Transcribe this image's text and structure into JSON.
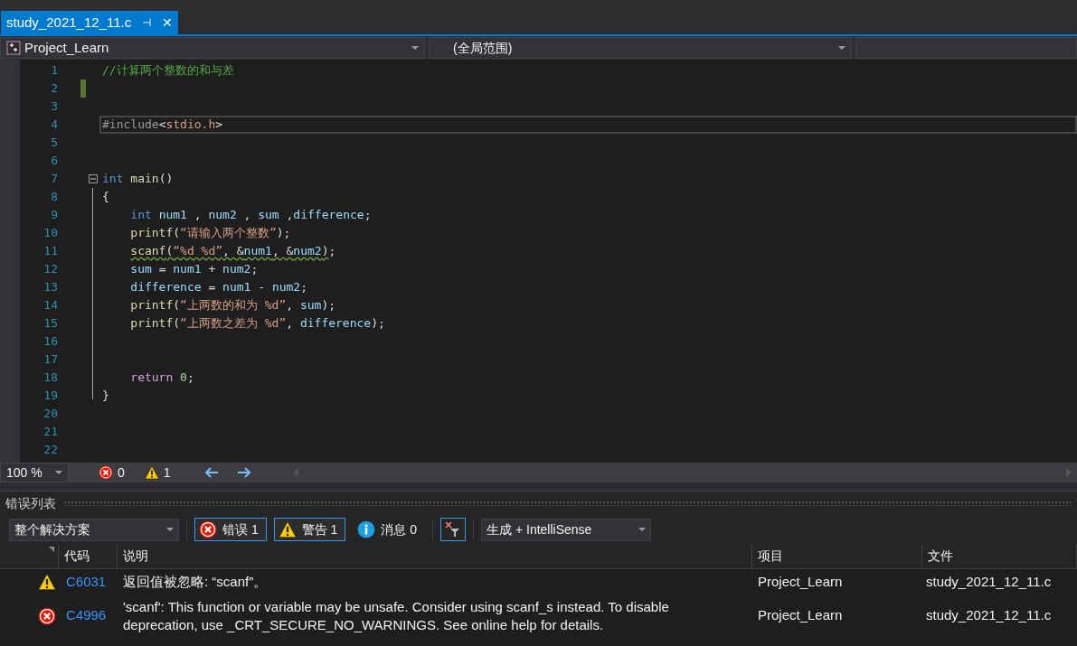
{
  "tab": {
    "title": "study_2021_12_11.c",
    "pin": "⊣",
    "close": "✕",
    "selected": true
  },
  "nav": {
    "project": "Project_Learn",
    "scope": "(全局范围)"
  },
  "editor": {
    "lines": [
      {
        "n": "1",
        "tokens": [
          {
            "kind": "comment",
            "text": "//计算两个整数的和与差"
          }
        ]
      },
      {
        "n": "2",
        "modified": true
      },
      {
        "n": "3"
      },
      {
        "n": "4",
        "current": true,
        "tokens": [
          {
            "kind": "preproc",
            "text": "#include"
          },
          {
            "kind": "plain",
            "text": "<"
          },
          {
            "kind": "string",
            "text": "stdio.h"
          },
          {
            "kind": "plain",
            "text": ">"
          }
        ]
      },
      {
        "n": "5"
      },
      {
        "n": "6"
      },
      {
        "n": "7",
        "expanded": true,
        "tokens": [
          {
            "kind": "keyword",
            "text": "int"
          },
          {
            "kind": "func",
            "text": " main"
          },
          {
            "kind": "plain",
            "text": "()"
          }
        ],
        "children": [
          {
            "n": "8",
            "tokens": [
              {
                "kind": "plain",
                "text": "{"
              }
            ]
          },
          {
            "n": "9",
            "tokens": [
              {
                "kind": "keyword",
                "text": "    int"
              },
              {
                "kind": "ident",
                "text": " num1"
              },
              {
                "kind": "plain",
                "text": " , "
              },
              {
                "kind": "ident",
                "text": "num2"
              },
              {
                "kind": "plain",
                "text": " , "
              },
              {
                "kind": "ident",
                "text": "sum"
              },
              {
                "kind": "plain",
                "text": " ,"
              },
              {
                "kind": "ident",
                "text": "difference"
              },
              {
                "kind": "plain",
                "text": ";"
              }
            ]
          },
          {
            "n": "10",
            "tokens": [
              {
                "kind": "func",
                "text": "    printf"
              },
              {
                "kind": "plain",
                "text": "("
              },
              {
                "kind": "string",
                "text": "“请输入两个整数”"
              },
              {
                "kind": "plain",
                "text": ");"
              }
            ]
          },
          {
            "n": "11",
            "warning": true,
            "tokens": [
              {
                "kind": "func",
                "text": "    scanf"
              },
              {
                "kind": "plain",
                "text": "("
              },
              {
                "kind": "string",
                "text": "“%d %d”"
              },
              {
                "kind": "plain",
                "text": ", &"
              },
              {
                "kind": "ident",
                "text": "num1"
              },
              {
                "kind": "plain",
                "text": ", &"
              },
              {
                "kind": "ident",
                "text": "num2"
              },
              {
                "kind": "plain",
                "text": ")"
              },
              {
                "kind": "plain",
                "text": ";"
              }
            ]
          },
          {
            "n": "12",
            "tokens": [
              {
                "kind": "ident",
                "text": "    sum"
              },
              {
                "kind": "plain",
                "text": " = "
              },
              {
                "kind": "ident",
                "text": "num1"
              },
              {
                "kind": "plain",
                "text": " + "
              },
              {
                "kind": "ident",
                "text": "num2"
              },
              {
                "kind": "plain",
                "text": ";"
              }
            ]
          },
          {
            "n": "13",
            "tokens": [
              {
                "kind": "ident",
                "text": "    difference"
              },
              {
                "kind": "plain",
                "text": " = "
              },
              {
                "kind": "ident",
                "text": "num1"
              },
              {
                "kind": "plain",
                "text": " - "
              },
              {
                "kind": "ident",
                "text": "num2"
              },
              {
                "kind": "plain",
                "text": ";"
              }
            ]
          },
          {
            "n": "14",
            "tokens": [
              {
                "kind": "func",
                "text": "    printf"
              },
              {
                "kind": "plain",
                "text": "("
              },
              {
                "kind": "string",
                "text": "“上两数的和为 %d”"
              },
              {
                "kind": "plain",
                "text": ", "
              },
              {
                "kind": "ident",
                "text": "sum"
              },
              {
                "kind": "plain",
                "text": ");"
              }
            ]
          },
          {
            "n": "15",
            "tokens": [
              {
                "kind": "func",
                "text": "    printf"
              },
              {
                "kind": "plain",
                "text": "("
              },
              {
                "kind": "string",
                "text": "“上两数之差为 %d”"
              },
              {
                "kind": "plain",
                "text": ", "
              },
              {
                "kind": "ident",
                "text": "difference"
              },
              {
                "kind": "plain",
                "text": ");"
              }
            ]
          },
          {
            "n": "16"
          },
          {
            "n": "17"
          },
          {
            "n": "18",
            "tokens": [
              {
                "kind": "control",
                "text": "    return"
              },
              {
                "kind": "number",
                "text": " 0"
              },
              {
                "kind": "plain",
                "text": ";"
              }
            ]
          },
          {
            "n": "19",
            "tokens": [
              {
                "kind": "plain",
                "text": "}"
              }
            ]
          }
        ]
      },
      {
        "n": "20"
      },
      {
        "n": "21"
      },
      {
        "n": "22"
      }
    ]
  },
  "status": {
    "zoom": "100 %",
    "errors": "0",
    "warnings": "1"
  },
  "error_list": {
    "title": "错误列表",
    "scope": "整个解决方案",
    "filters": [
      {
        "kind": "error",
        "label": "错误 1",
        "selected": true
      },
      {
        "kind": "warning",
        "label": "警告 1",
        "selected": true
      },
      {
        "kind": "info",
        "label": "消息 0",
        "selected": false
      }
    ],
    "source": "生成 + IntelliSense",
    "columns": [
      "代码",
      "说明",
      "项目",
      "文件"
    ],
    "rows": [
      {
        "kind": "warning",
        "code": "C6031",
        "description": "返回值被忽略: “scanf”。",
        "project": "Project_Learn",
        "file": "study_2021_12_11.c"
      },
      {
        "kind": "error",
        "code": "C4996",
        "description": "'scanf': This function or variable may be unsafe. Consider using scanf_s instead. To disable deprecation, use _CRT_SECURE_NO_WARNINGS. See online help for details.",
        "project": "Project_Learn",
        "file": "study_2021_12_11.c"
      }
    ]
  }
}
